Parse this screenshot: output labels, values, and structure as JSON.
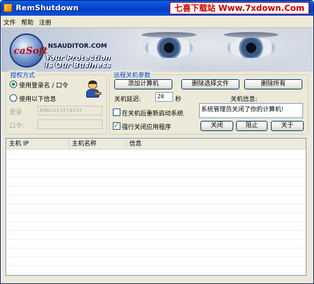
{
  "window": {
    "title": "RemShutdown",
    "watermark": "七喜下载站 Www.7xdown.Com"
  },
  "menu": {
    "items": [
      "文件",
      "帮助",
      "注册"
    ]
  },
  "banner": {
    "logo_text": "caSoft",
    "brand": "NSAUDITOR.COM",
    "slogan_line1": "Your Protection",
    "slogan_line2": "Is Our Business"
  },
  "auth": {
    "title": "授权方式",
    "option_login": "使用登录名 / 口令",
    "option_following": "使用以下信息",
    "selected": "option_login",
    "login_label": "登录",
    "login_value": "Administrator",
    "password_label": "口令:",
    "password_value": ""
  },
  "remote": {
    "title": "远程关机参数",
    "add_button": "添加计算机",
    "remove_selected_button": "删除选择文件",
    "remove_all_button": "删除所有",
    "delay_label": "关机延迟:",
    "delay_value": "20",
    "delay_unit": "秒",
    "message_label": "关机信息:",
    "message_value": "系统管理员关闭了你的计算机!",
    "restart_label": "在关机后重新启动系统",
    "restart_checked": false,
    "force_label": "强行关闭应用程序",
    "force_checked": true,
    "shutdown_button": "关闭",
    "abort_button": "阻止",
    "about_button": "关于"
  },
  "table": {
    "columns": [
      "主机 IP",
      "主机名称",
      "信息"
    ],
    "rows": []
  }
}
